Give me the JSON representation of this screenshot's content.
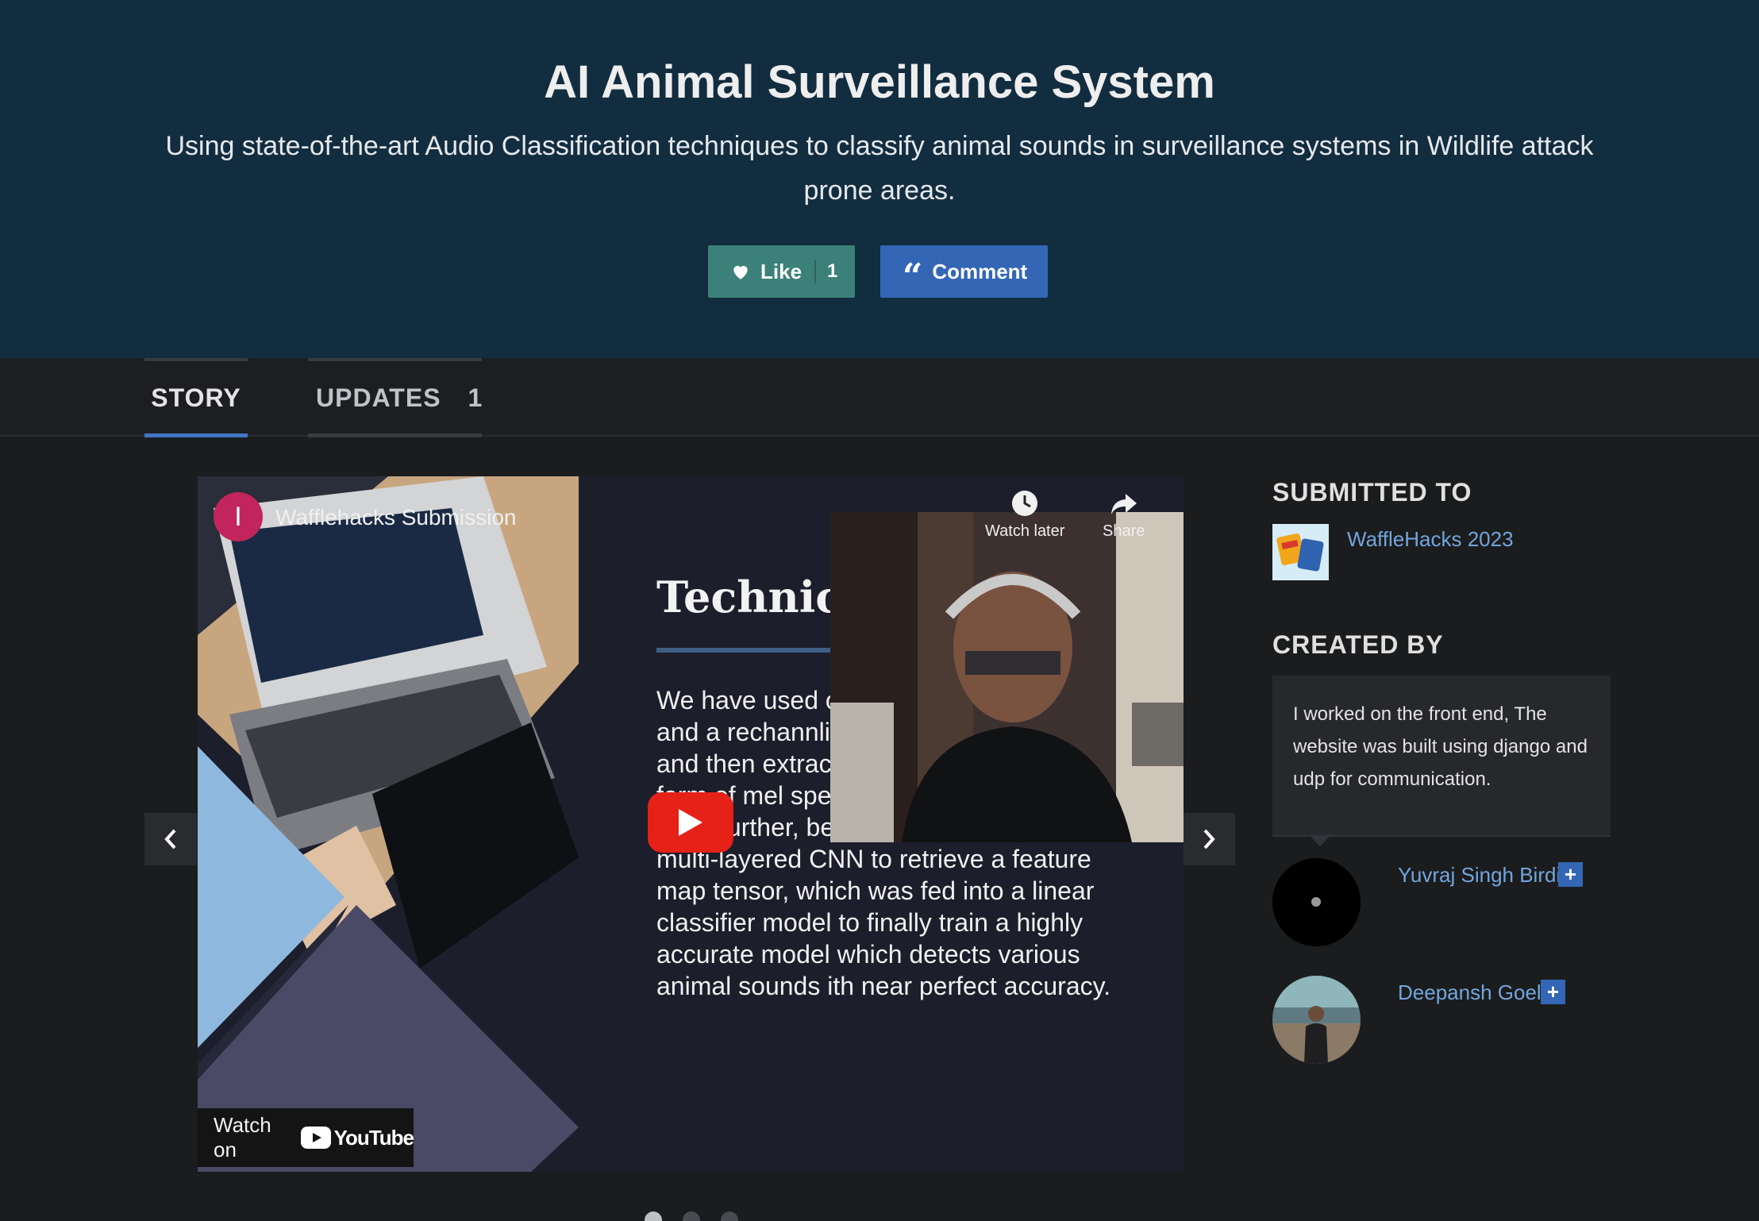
{
  "project": {
    "title": "AI Animal Surveillance System",
    "tagline": "Using state-of-the-art Audio Classification techniques to classify animal sounds in surveillance systems in Wildlife attack prone areas."
  },
  "actions": {
    "like_label": "Like",
    "like_count": "1",
    "comment_label": "Comment"
  },
  "tabs": [
    {
      "label": "STORY",
      "active": true
    },
    {
      "label": "UPDATES",
      "count": "1",
      "active": false
    }
  ],
  "video": {
    "channel_initial": "I",
    "channel_title": "Wafflehacks Submission",
    "watch_later_label": "Watch later",
    "share_label": "Share",
    "slide_title": "Technica",
    "slide_text": "We have used o train our model transform and a rechannlizing, re ls, and tir tensors, and then extracting their features in the form of mel spectrograms, and augmented them further, before feeding them into our multi-layered CNN to retrieve a feature map tensor, which was fed into a linear classifier model to finally train a highly accurate model which detects various animal sounds ith near perfect accuracy.",
    "watch_on_label": "Watch on",
    "youtube_label": "YouTube"
  },
  "carousel": {
    "slide_count": 3,
    "active_index": 0
  },
  "sidebar": {
    "submitted_heading": "SUBMITTED TO",
    "hackathon_name": "WaffleHacks 2023",
    "created_heading": "CREATED BY",
    "creator_note": "I worked on the front end, The website was built using django and udp for communication.",
    "members": [
      {
        "name": "Yuvraj Singh Birdi",
        "follow": "+"
      },
      {
        "name": "Deepansh Goel",
        "follow": "+"
      }
    ]
  },
  "colors": {
    "hero_bg": "#132d40",
    "like_btn": "#3c8179",
    "comment_btn": "#3367b5",
    "link": "#72a6dd",
    "tab_active": "#3e76c5",
    "play_button": "#e62117"
  }
}
